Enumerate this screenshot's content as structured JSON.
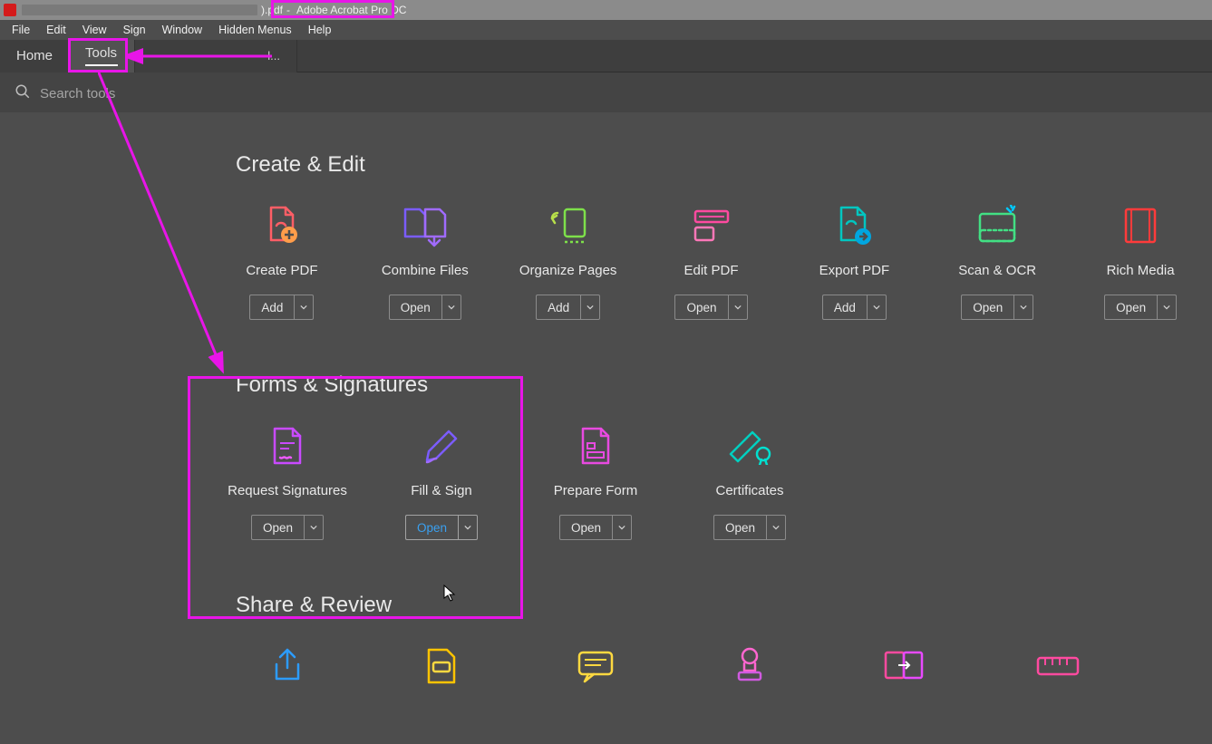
{
  "titlebar": {
    "pdf_ext": ").pdf",
    "separator": "-",
    "app_name": "Adobe Acrobat Pro DC"
  },
  "menubar": {
    "items": [
      "File",
      "Edit",
      "View",
      "Sign",
      "Window",
      "Hidden Menus",
      "Help"
    ]
  },
  "maintabs": {
    "home": "Home",
    "tools": "Tools",
    "doc_tab_tail": "l..."
  },
  "search": {
    "placeholder": "Search tools"
  },
  "sections": [
    {
      "title": "Create & Edit",
      "tools": [
        {
          "label": "Create PDF",
          "action": "Add",
          "icon": "create-pdf",
          "color": "#ff5e66",
          "accent": "#ff9d4a"
        },
        {
          "label": "Combine Files",
          "action": "Open",
          "icon": "combine-files",
          "color": "#7b5cff",
          "accent": "#a06bff"
        },
        {
          "label": "Organize Pages",
          "action": "Add",
          "icon": "organize-pages",
          "color": "#7ee04a",
          "accent": "#b8e04a"
        },
        {
          "label": "Edit PDF",
          "action": "Open",
          "icon": "edit-pdf",
          "color": "#ff4aa0",
          "accent": "#ff77b8"
        },
        {
          "label": "Export PDF",
          "action": "Add",
          "icon": "export-pdf",
          "color": "#00c6c0",
          "accent": "#00a6e0"
        },
        {
          "label": "Scan & OCR",
          "action": "Open",
          "icon": "scan-ocr",
          "color": "#42e084",
          "accent": "#00c8ff"
        },
        {
          "label": "Rich Media",
          "action": "Open",
          "icon": "rich-media",
          "color": "#ff3b3b",
          "accent": "#ff6b6b"
        }
      ]
    },
    {
      "title": "Forms & Signatures",
      "tools": [
        {
          "label": "Request Signatures",
          "action": "Open",
          "icon": "request-sign",
          "color": "#c94aff",
          "accent": "#ef5aff"
        },
        {
          "label": "Fill & Sign",
          "action": "Open",
          "icon": "fill-sign",
          "color": "#7b5cff",
          "accent": "#a06bff",
          "hover": true
        },
        {
          "label": "Prepare Form",
          "action": "Open",
          "icon": "prepare-form",
          "color": "#e84ae0",
          "accent": "#ff5af0"
        },
        {
          "label": "Certificates",
          "action": "Open",
          "icon": "certificates",
          "color": "#00d0c0",
          "accent": "#00e0d0"
        }
      ]
    },
    {
      "title": "Share & Review",
      "tools": [
        {
          "label": "",
          "action": "",
          "icon": "share",
          "color": "#2c9cff",
          "accent": "#2c9cff"
        },
        {
          "label": "",
          "action": "",
          "icon": "send-comments",
          "color": "#ffc400",
          "accent": "#ffd940"
        },
        {
          "label": "",
          "action": "",
          "icon": "comment",
          "color": "#ffd940",
          "accent": "#ffc400"
        },
        {
          "label": "",
          "action": "",
          "icon": "stamp",
          "color": "#ff66d0",
          "accent": "#d05ae0"
        },
        {
          "label": "",
          "action": "",
          "icon": "compare",
          "color": "#ff4aa0",
          "accent": "#e84aff"
        },
        {
          "label": "",
          "action": "",
          "icon": "measure",
          "color": "#ff4aa0",
          "accent": "#ff77b8"
        }
      ]
    }
  ]
}
